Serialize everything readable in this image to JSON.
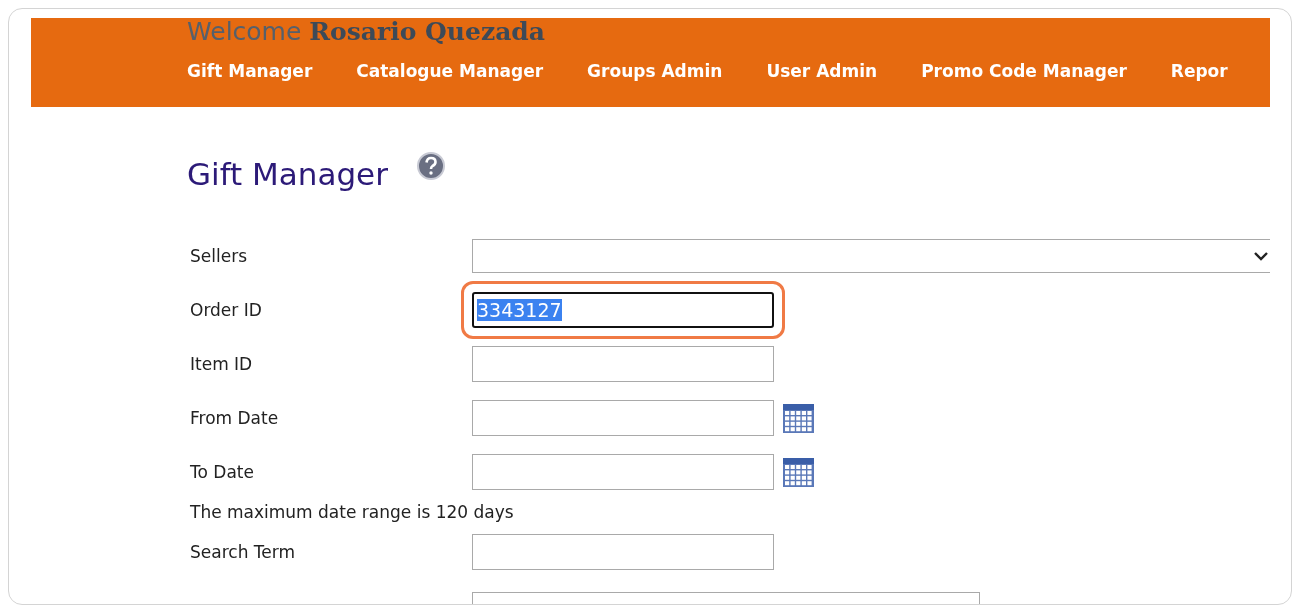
{
  "header": {
    "welcome": "Welcome **Rosario Quezada**",
    "nav": [
      {
        "label": "Gift Manager"
      },
      {
        "label": "Catalogue Manager"
      },
      {
        "label": "Groups Admin"
      },
      {
        "label": "User Admin"
      },
      {
        "label": "Promo Code Manager"
      },
      {
        "label": "Repor"
      }
    ]
  },
  "page": {
    "title": "Gift Manager"
  },
  "form": [
    {
      "kind": "select",
      "label": "Sellers",
      "focused": false
    },
    {
      "kind": "text",
      "label": "Order ID",
      "value": "3343127",
      "focused": true,
      "value_selected": true
    },
    {
      "kind": "text",
      "label": "Item ID",
      "focused": false
    },
    {
      "kind": "date",
      "label": "From Date",
      "focused": false
    },
    {
      "kind": "date",
      "label": "To Date",
      "focused": false
    },
    {
      "kind": "note",
      "text": "The maximum date range is 120 days"
    },
    {
      "kind": "text",
      "label": "Search Term",
      "focused": false
    },
    {
      "kind": "partial",
      "focused": false
    }
  ]
}
